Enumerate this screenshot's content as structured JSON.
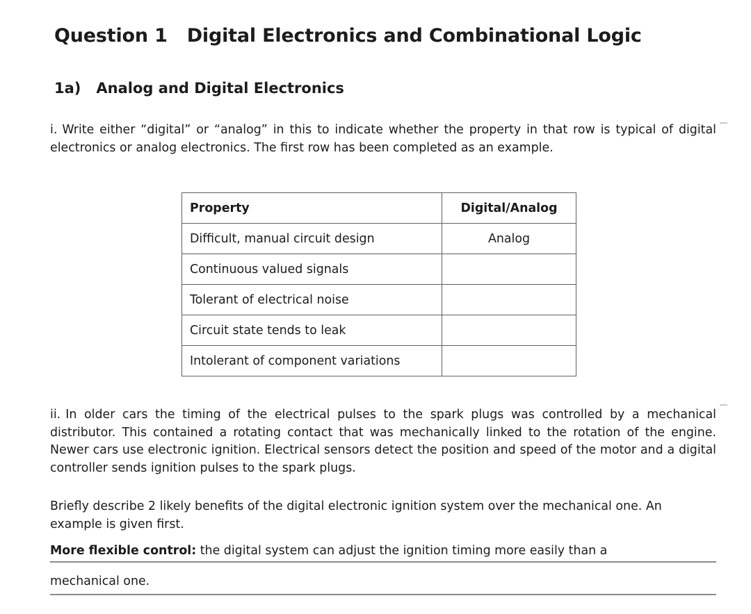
{
  "document": {
    "title": {
      "label": "Question 1",
      "text": "Digital Electronics and Combinational Logic"
    },
    "subtitle": {
      "label": "1a)",
      "text": "Analog and Digital Electronics"
    }
  },
  "parts": {
    "i": {
      "marker": "i.",
      "text": "Write either “digital” or “analog” in this to indicate whether the property in that row is typical of digital electronics or analog electronics.  The first row has been completed as an example."
    },
    "ii": {
      "marker": "ii.",
      "text": "In older cars the timing of the electrical pulses to the spark plugs was controlled by a mechanical distributor.  This contained a rotating contact that was mechanically linked to the rotation of the engine.  Newer cars use electronic ignition.  Electrical sensors detect the position and speed of the motor and a digital controller sends ignition pulses to the spark plugs."
    },
    "brief": {
      "text": "Briefly describe 2 likely benefits of the digital electronic ignition system over the mechanical one.  An example is given first."
    }
  },
  "table": {
    "headers": [
      "Property",
      "Digital/Analog"
    ],
    "rows": [
      {
        "property": "Difficult, manual circuit design",
        "value": "Analog"
      },
      {
        "property": "Continuous valued signals",
        "value": ""
      },
      {
        "property": "Tolerant of electrical noise",
        "value": ""
      },
      {
        "property": "Circuit state tends to leak",
        "value": ""
      },
      {
        "property": "Intolerant of component variations",
        "value": ""
      }
    ]
  },
  "answer": {
    "lead": "More flexible control:",
    "line1": "the digital system can adjust the ignition timing more easily than a",
    "line2": "mechanical one."
  },
  "colors": {
    "text": "#1c1c1c",
    "table_border": "#5f5f5f",
    "rule": "#8a8a8a",
    "background": "#ffffff"
  }
}
